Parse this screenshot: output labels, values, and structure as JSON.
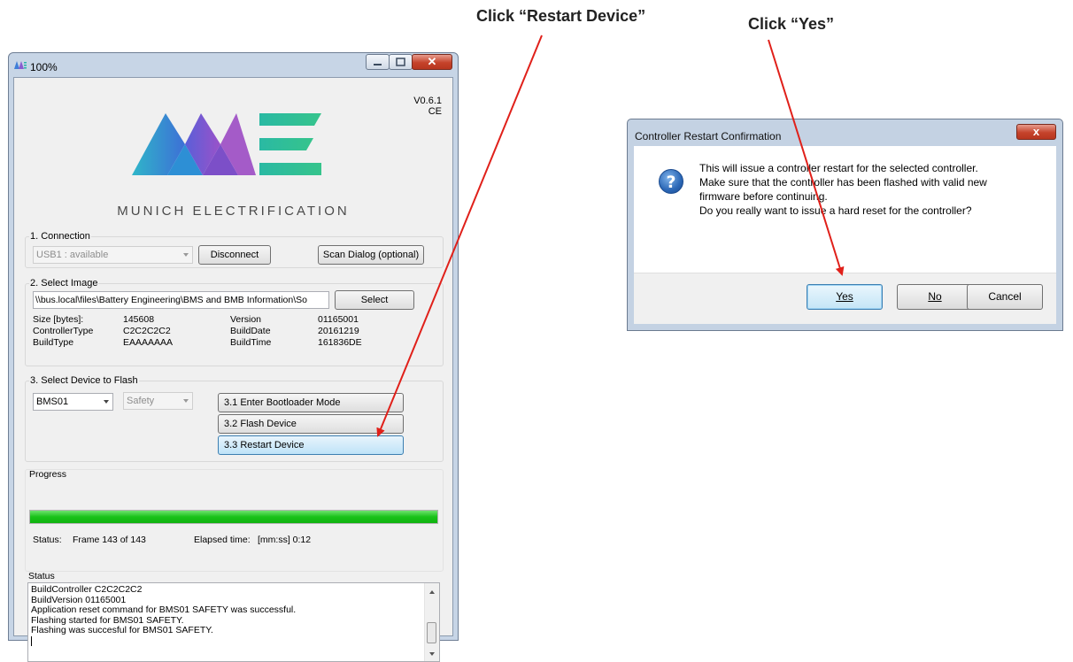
{
  "annotations": {
    "restart": "Click “Restart Device”",
    "yes": "Click “Yes”"
  },
  "app_window": {
    "title": "100%",
    "version": "V0.6.1",
    "edition": "CE",
    "brand": "MUNICH ELECTRIFICATION",
    "connection": {
      "label": "1. Connection",
      "port_value": "USB1 : available",
      "disconnect_label": "Disconnect",
      "scan_label": "Scan Dialog (optional)"
    },
    "image": {
      "label": "2. Select Image",
      "path": "\\\\bus.local\\files\\Battery Engineering\\BMS and BMB Information\\So",
      "select_label": "Select",
      "size_label": "Size [bytes]:",
      "size_value": "145608",
      "controller_type_label": "ControllerType",
      "controller_type_value": "C2C2C2C2",
      "build_type_label": "BuildType",
      "build_type_value": "EAAAAAAA",
      "version_label": "Version",
      "version_value": "01165001",
      "build_date_label": "BuildDate",
      "build_date_value": "20161219",
      "build_time_label": "BuildTime",
      "build_time_value": "161836DE"
    },
    "device": {
      "label": "3. Select Device to Flash",
      "device_value": "BMS01",
      "safety_value": "Safety",
      "bootloader_label": "3.1 Enter Bootloader Mode",
      "flash_label": "3.2 Flash Device",
      "restart_label": "3.3 Restart Device"
    },
    "progress": {
      "label": "Progress",
      "fraction": 1.0,
      "status_label": "Status:",
      "status_value": "Frame 143 of 143",
      "elapsed_label": "Elapsed time:",
      "elapsed_value": "[mm:ss] 0:12"
    },
    "status_log": {
      "label": "Status",
      "lines": [
        "BuildController C2C2C2C2",
        "BuildVersion 01165001",
        "Application reset command for BMS01 SAFETY was successful.",
        "Flashing started for BMS01 SAFETY.",
        "Flashing was succesful for BMS01 SAFETY."
      ]
    }
  },
  "dialog": {
    "title": "Controller Restart Confirmation",
    "icon": "question-icon",
    "message": [
      "This will issue a controller restart for the selected controller.",
      "Make sure that the controller has been flashed with valid new",
      "firmware before continuing.",
      "Do you really want to issue a hard reset for the controller?"
    ],
    "yes_label": "Yes",
    "no_label": "No",
    "cancel_label": "Cancel",
    "close_label": "x"
  },
  "colors": {
    "progress_green": "#19c219",
    "annotation_arrow": "#e0201a",
    "window_frame": "#c7d5e6"
  }
}
